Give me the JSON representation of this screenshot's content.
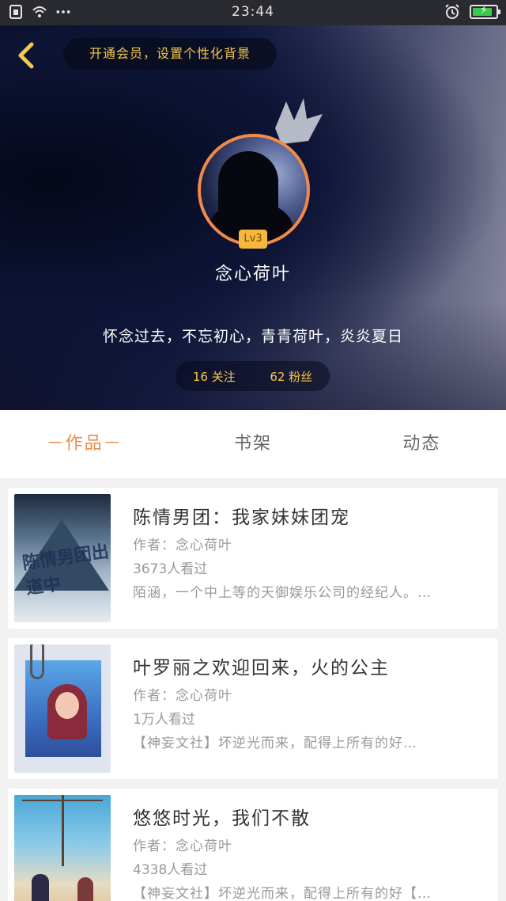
{
  "status_bar": {
    "time": "23:44",
    "battery_level": 0.85,
    "icons": [
      "sim-icon",
      "wifi-icon",
      "more-dots-icon",
      "alarm-icon",
      "battery-icon"
    ]
  },
  "header": {
    "vip_banner": "开通会员，设置个性化背景",
    "level": "Lv3",
    "username": "念心荷叶",
    "bio": "怀念过去，不忘初心，青青荷叶，炎炎夏日",
    "following": "16 关注",
    "followers": "62 粉丝",
    "accent_color": "#f08a4b",
    "gold_color": "#f2c94c"
  },
  "tabs": [
    {
      "label": "－作品－",
      "active": true
    },
    {
      "label": "书架",
      "active": false
    },
    {
      "label": "动态",
      "active": false
    }
  ],
  "books": [
    {
      "title": "陈情男团：我家妹妹团宠",
      "author": "作者：念心荷叶",
      "views": "3673人看过",
      "desc": "陌涵，一个中上等的天御娱乐公司的经纪人。…",
      "cover_text": "陈情男团出道中"
    },
    {
      "title": "叶罗丽之欢迎回来，火的公主",
      "author": "作者：念心荷叶",
      "views": "1万人看过",
      "desc": "【神妄文社】坏逆光而来，配得上所有的好…"
    },
    {
      "title": "悠悠时光，我们不散",
      "author": "作者：念心荷叶",
      "views": "4338人看过",
      "desc": "【神妄文社】坏逆光而来，配得上所有的好【…"
    }
  ]
}
